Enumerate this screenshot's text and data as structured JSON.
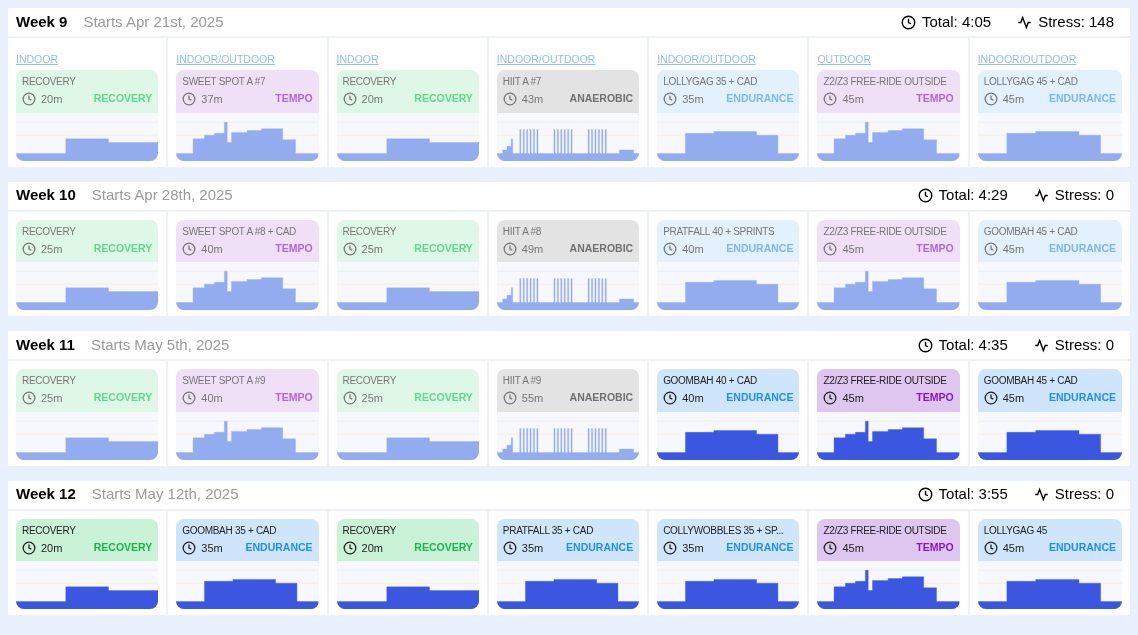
{
  "weeks": [
    {
      "title": "Week 9",
      "starts": "Starts Apr 21st, 2025",
      "total": "Total: 4:05",
      "stress": "Stress: 148",
      "days": [
        {
          "location": "INDOOR",
          "name": "RECOVERY",
          "duration": "20m",
          "zone": "RECOVERY",
          "kind": "recovery",
          "done": true
        },
        {
          "location": "INDOOR/OUTDOOR",
          "name": "SWEET SPOT A #7",
          "duration": "37m",
          "zone": "TEMPO",
          "kind": "tempo",
          "done": true
        },
        {
          "location": "INDOOR",
          "name": "RECOVERY",
          "duration": "20m",
          "zone": "RECOVERY",
          "kind": "recovery",
          "done": true
        },
        {
          "location": "INDOOR/OUTDOOR",
          "name": "HIIT A #7",
          "duration": "43m",
          "zone": "ANAEROBIC",
          "kind": "anaerobic",
          "done": true
        },
        {
          "location": "INDOOR/OUTDOOR",
          "name": "LOLLYGAG 35 + CAD",
          "duration": "35m",
          "zone": "ENDURANCE",
          "kind": "endurance",
          "done": true
        },
        {
          "location": "OUTDOOR",
          "name": "Z2/Z3 FREE-RIDE OUTSIDE",
          "duration": "45m",
          "zone": "TEMPO",
          "kind": "tempo",
          "done": true
        },
        {
          "location": "INDOOR/OUTDOOR",
          "name": "LOLLYGAG 45 + CAD",
          "duration": "45m",
          "zone": "ENDURANCE",
          "kind": "endurance",
          "done": true
        }
      ]
    },
    {
      "title": "Week 10",
      "starts": "Starts Apr 28th, 2025",
      "total": "Total: 4:29",
      "stress": "Stress: 0",
      "days": [
        {
          "name": "RECOVERY",
          "duration": "25m",
          "zone": "RECOVERY",
          "kind": "recovery",
          "done": true
        },
        {
          "name": "SWEET SPOT A #8 + CAD",
          "duration": "40m",
          "zone": "TEMPO",
          "kind": "tempo",
          "done": true
        },
        {
          "name": "RECOVERY",
          "duration": "25m",
          "zone": "RECOVERY",
          "kind": "recovery",
          "done": true
        },
        {
          "name": "HIIT A #8",
          "duration": "49m",
          "zone": "ANAEROBIC",
          "kind": "anaerobic",
          "done": true
        },
        {
          "name": "PRATFALL 40 + SPRINTS",
          "duration": "40m",
          "zone": "ENDURANCE",
          "kind": "endurance",
          "done": true
        },
        {
          "name": "Z2/Z3 FREE-RIDE OUTSIDE",
          "duration": "45m",
          "zone": "TEMPO",
          "kind": "tempo",
          "done": true
        },
        {
          "name": "GOOMBAH 45 + CAD",
          "duration": "45m",
          "zone": "ENDURANCE",
          "kind": "endurance",
          "done": true
        }
      ]
    },
    {
      "title": "Week 11",
      "starts": "Starts May 5th, 2025",
      "total": "Total: 4:35",
      "stress": "Stress: 0",
      "days": [
        {
          "name": "RECOVERY",
          "duration": "25m",
          "zone": "RECOVERY",
          "kind": "recovery",
          "done": true
        },
        {
          "name": "SWEET SPOT A #9",
          "duration": "40m",
          "zone": "TEMPO",
          "kind": "tempo",
          "done": true
        },
        {
          "name": "RECOVERY",
          "duration": "25m",
          "zone": "RECOVERY",
          "kind": "recovery",
          "done": true
        },
        {
          "name": "HIIT A #9",
          "duration": "55m",
          "zone": "ANAEROBIC",
          "kind": "anaerobic",
          "done": true
        },
        {
          "name": "GOOMBAH 40 + CAD",
          "duration": "40m",
          "zone": "ENDURANCE",
          "kind": "endurance",
          "done": false
        },
        {
          "name": "Z2/Z3 FREE-RIDE OUTSIDE",
          "duration": "45m",
          "zone": "TEMPO",
          "kind": "tempo",
          "done": false
        },
        {
          "name": "GOOMBAH 45 + CAD",
          "duration": "45m",
          "zone": "ENDURANCE",
          "kind": "endurance",
          "done": false
        }
      ]
    },
    {
      "title": "Week 12",
      "starts": "Starts May 12th, 2025",
      "total": "Total: 3:55",
      "stress": "Stress: 0",
      "days": [
        {
          "name": "RECOVERY",
          "duration": "20m",
          "zone": "RECOVERY",
          "kind": "recovery",
          "done": false
        },
        {
          "name": "GOOMBAH 35 + CAD",
          "duration": "35m",
          "zone": "ENDURANCE",
          "kind": "endurance",
          "done": false
        },
        {
          "name": "RECOVERY",
          "duration": "20m",
          "zone": "RECOVERY",
          "kind": "recovery",
          "done": false
        },
        {
          "name": "PRATFALL 35 + CAD",
          "duration": "35m",
          "zone": "ENDURANCE",
          "kind": "endurance",
          "done": false
        },
        {
          "name": "COLLYWOBBLES 35 + SP...",
          "duration": "35m",
          "zone": "ENDURANCE",
          "kind": "endurance",
          "done": false
        },
        {
          "name": "Z2/Z3 FREE-RIDE OUTSIDE",
          "duration": "45m",
          "zone": "TEMPO",
          "kind": "tempo",
          "done": false
        },
        {
          "name": "LOLLYGAG 45",
          "duration": "45m",
          "zone": "ENDURANCE",
          "kind": "endurance",
          "done": false
        }
      ]
    }
  ]
}
